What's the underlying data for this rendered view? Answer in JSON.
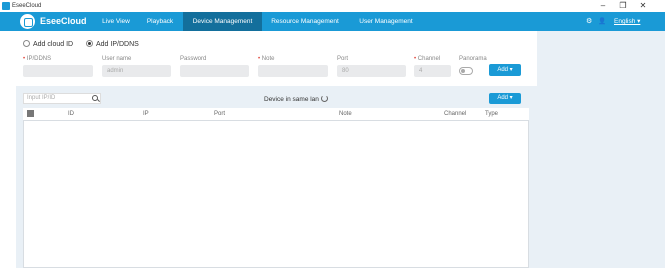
{
  "window": {
    "title": "EseeCloud",
    "minimize": "–",
    "maximize": "❐",
    "close": "✕"
  },
  "nav": {
    "brand": "EseeCloud",
    "tabs": [
      "Live View",
      "Playback",
      "Device Management",
      "Resource Management",
      "User Management"
    ],
    "active_tab": "Device Management",
    "settings_icon": "⚙",
    "user_icon": "👤",
    "language": "English ▾"
  },
  "add_form": {
    "mode_cloud": "Add cloud ID",
    "mode_ip": "Add IP/DDNS",
    "selected_mode": "Add IP/DDNS",
    "fields": {
      "ip": {
        "label": "IP/DDNS",
        "required": "•",
        "value": ""
      },
      "username": {
        "label": "User name",
        "value": "admin"
      },
      "password": {
        "label": "Password",
        "value": ""
      },
      "note": {
        "label": "Note",
        "required": "•",
        "value": ""
      },
      "port": {
        "label": "Port",
        "value": "80"
      },
      "channel": {
        "label": "Channel",
        "required": "•",
        "value": "4"
      },
      "panorama": {
        "label": "Panorama",
        "enabled": false
      }
    },
    "add_button": "Add ▾"
  },
  "device_list": {
    "search_placeholder": "Input IP/ID",
    "lan_label": "Device in same lan",
    "add_button": "Add ▾",
    "columns": [
      "ID",
      "IP",
      "Port",
      "Note",
      "Channel",
      "Type"
    ],
    "rows": []
  },
  "colors": {
    "accent": "#1a9ad6",
    "active_tab": "#136f9c",
    "panel_bg": "#e9f0f6"
  }
}
